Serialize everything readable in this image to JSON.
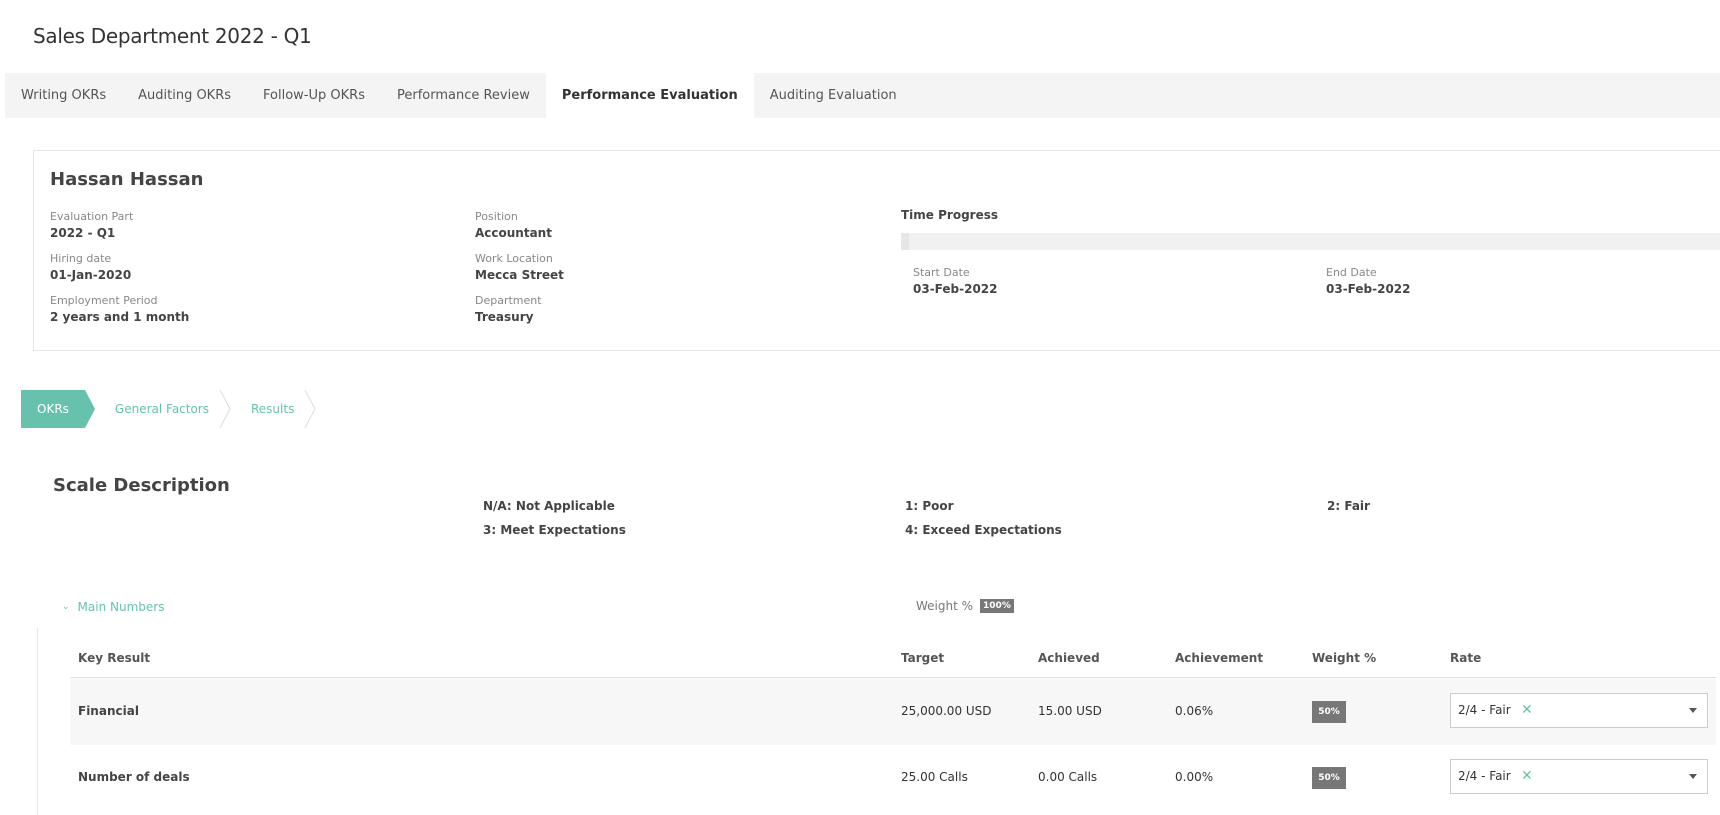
{
  "page": {
    "title": "Sales Department 2022 - Q1"
  },
  "tabs": [
    {
      "label": "Writing OKRs"
    },
    {
      "label": "Auditing OKRs"
    },
    {
      "label": "Follow-Up OKRs"
    },
    {
      "label": "Performance Review"
    },
    {
      "label": "Performance Evaluation",
      "active": true
    },
    {
      "label": "Auditing Evaluation"
    }
  ],
  "employee": {
    "name": "Hassan Hassan",
    "evaluation_part_label": "Evaluation Part",
    "evaluation_part": "2022 - Q1",
    "hiring_date_label": "Hiring date",
    "hiring_date": "01-Jan-2020",
    "employment_period_label": "Employment Period",
    "employment_period": "2 years and 1 month",
    "position_label": "Position",
    "position": "Accountant",
    "work_location_label": "Work Location",
    "work_location": "Mecca Street",
    "department_label": "Department",
    "department": "Treasury"
  },
  "time_progress": {
    "title": "Time Progress",
    "progress_fraction": 0.01,
    "start_label": "Start Date",
    "start_date": "03-Feb-2022",
    "end_label": "End Date",
    "end_date": "03-Feb-2022"
  },
  "steps": [
    {
      "label": "OKRs",
      "active": true
    },
    {
      "label": "General Factors"
    },
    {
      "label": "Results"
    }
  ],
  "scale": {
    "title": "Scale Description",
    "items": [
      "N/A: Not Applicable",
      "1: Poor",
      "2: Fair",
      "3: Meet Expectations",
      "4: Exceed Expectations"
    ]
  },
  "section": {
    "label": "Main Numbers",
    "weight_label": "Weight %",
    "weight_value": "100%"
  },
  "table": {
    "headers": [
      "Key Result",
      "Target",
      "Achieved",
      "Achievement",
      "Weight %",
      "Rate"
    ],
    "rows": [
      {
        "key_result": "Financial",
        "target": "25,000.00 USD",
        "achieved": "15.00 USD",
        "achievement": "0.06%",
        "weight": "50%",
        "rate": "2/4 - Fair"
      },
      {
        "key_result": "Number of deals",
        "target": "25.00 Calls",
        "achieved": "0.00 Calls",
        "achievement": "0.00%",
        "weight": "50%",
        "rate": "2/4 - Fair"
      }
    ]
  },
  "colors": {
    "accent": "#67c2ad",
    "badge": "#777777"
  },
  "icons": {
    "clear": "close-icon",
    "dropdown": "chevron-down-icon",
    "collapse": "chevron-down-icon"
  },
  "glyphs": {
    "clear": "✕",
    "collapse": "⌄"
  }
}
